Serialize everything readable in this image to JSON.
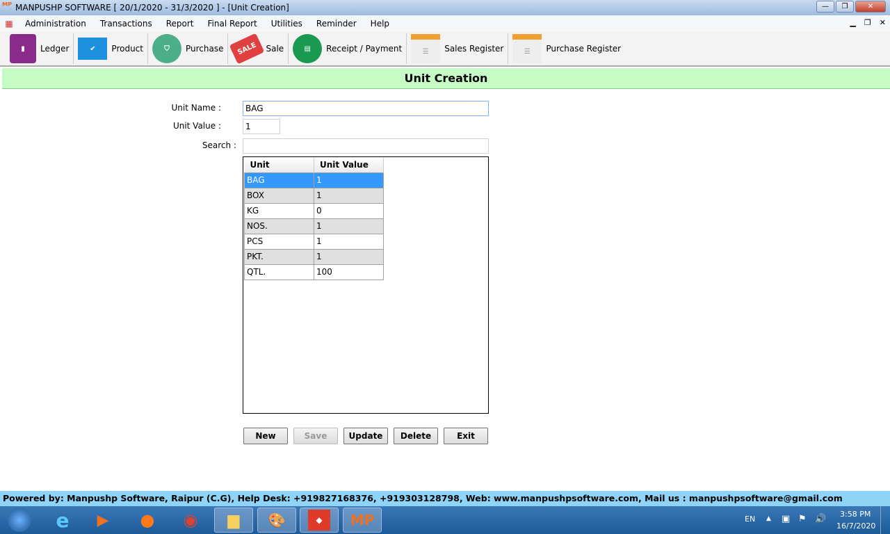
{
  "window": {
    "title": "MANPUSHP SOFTWARE [ 20/1/2020 - 31/3/2020 ]   - [Unit Creation]"
  },
  "menu": [
    "Administration",
    "Transactions",
    "Report",
    "Final Report",
    "Utilities",
    "Reminder",
    "Help"
  ],
  "toolbar": [
    {
      "label": "Ledger",
      "icon": "ledger-book-icon",
      "color": "#8a2a8a"
    },
    {
      "label": "Product",
      "icon": "products-icon",
      "color": "#1e90e0"
    },
    {
      "label": "Purchase",
      "icon": "basket-icon",
      "color": "#4caf8a"
    },
    {
      "label": "Sale",
      "icon": "sale-tag-icon",
      "color": "#e04040"
    },
    {
      "label": "Receipt / Payment",
      "icon": "receipt-icon",
      "color": "#1a9a50"
    },
    {
      "label": "Sales Register",
      "icon": "register-icon",
      "color": "#f0a030"
    },
    {
      "label": "Purchase Register",
      "icon": "register-icon",
      "color": "#40a060"
    }
  ],
  "form": {
    "title": "Unit Creation",
    "unit_name_label": "Unit Name :",
    "unit_name_value": "BAG",
    "unit_value_label": "Unit Value :",
    "unit_value_value": "1",
    "search_label": "Search :",
    "search_value": ""
  },
  "grid": {
    "columns": [
      "Unit",
      "Unit Value"
    ],
    "rows": [
      [
        "BAG",
        "1"
      ],
      [
        "BOX",
        "1"
      ],
      [
        "KG",
        "0"
      ],
      [
        "NOS.",
        "1"
      ],
      [
        "PCS",
        "1"
      ],
      [
        "PKT.",
        "1"
      ],
      [
        "QTL.",
        "100"
      ]
    ],
    "selected_row": 0
  },
  "buttons": {
    "new": "New",
    "save": "Save",
    "update": "Update",
    "delete": "Delete",
    "exit": "Exit"
  },
  "status": "Powered by: Manpushp Software, Raipur (C.G), Help Desk: +919827168376, +919303128798, Web: www.manpushpsoftware.com,  Mail us :  manpushpsoftware@gmail.com",
  "taskbar": {
    "lang": "EN",
    "time": "3:58 PM",
    "date": "16/7/2020"
  }
}
